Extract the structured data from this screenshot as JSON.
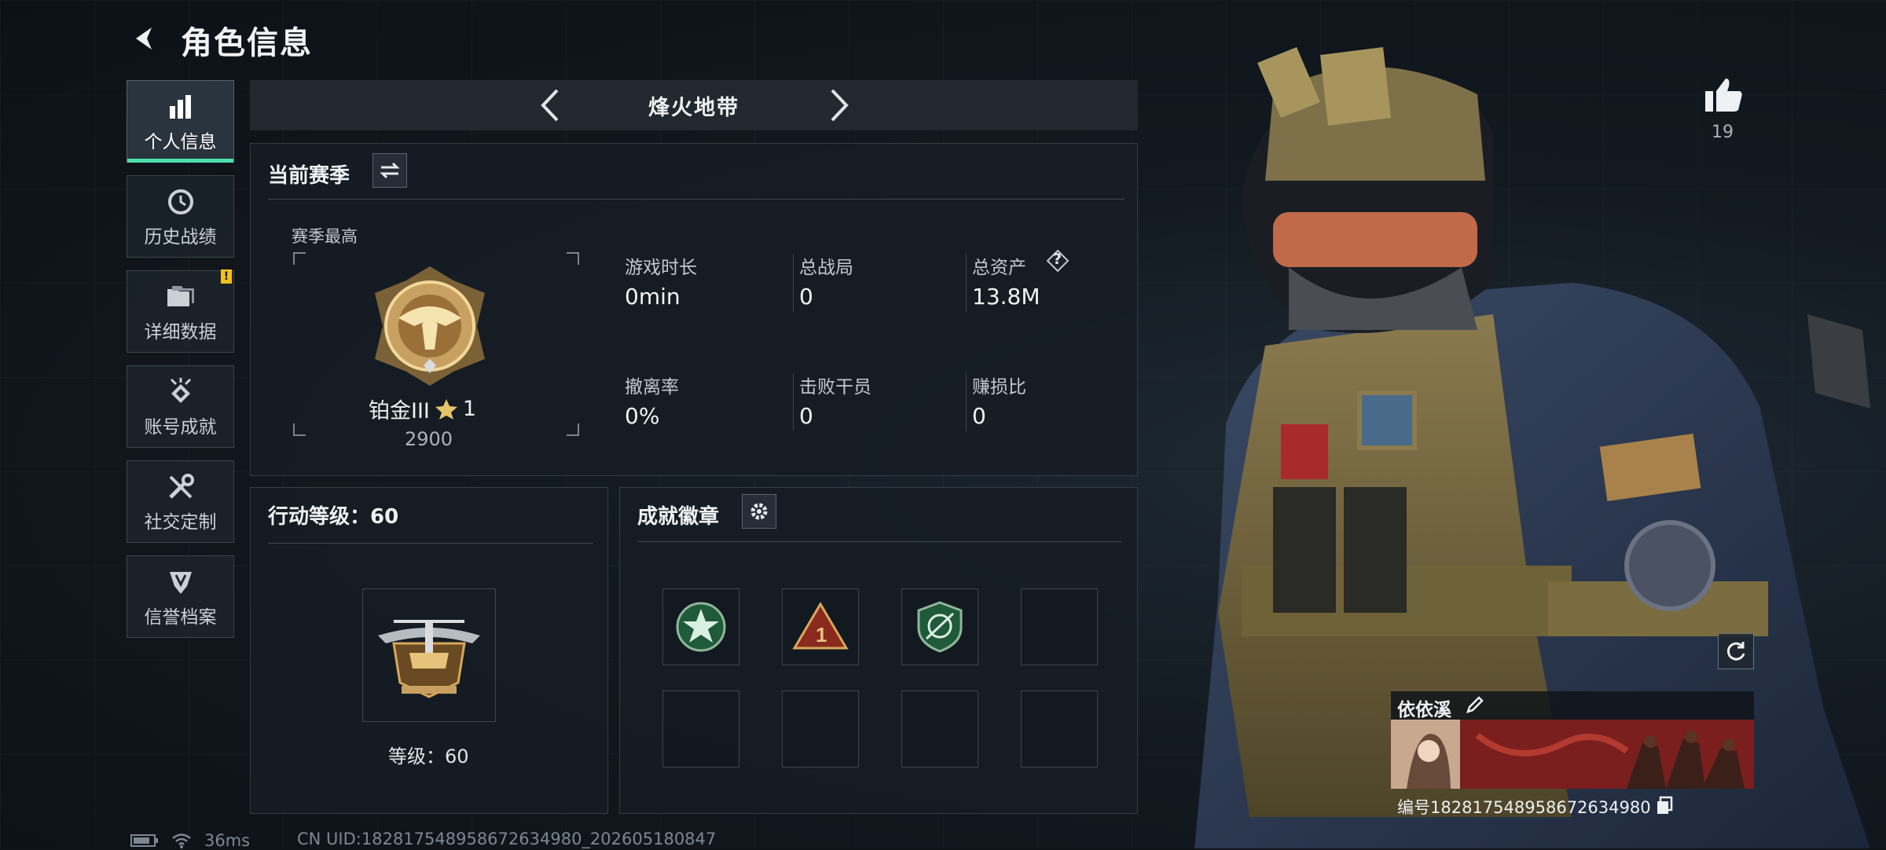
{
  "header": {
    "title": "角色信息"
  },
  "sidebar": {
    "items": [
      {
        "label": "个人信息",
        "icon": "bar-chart-icon",
        "active": true
      },
      {
        "label": "历史战绩",
        "icon": "clock-icon"
      },
      {
        "label": "详细数据",
        "icon": "folder-icon",
        "alert": "!"
      },
      {
        "label": "账号成就",
        "icon": "achievement-icon"
      },
      {
        "label": "社交定制",
        "icon": "tools-icon"
      },
      {
        "label": "信誉档案",
        "icon": "shield-icon"
      }
    ]
  },
  "mode": {
    "title": "烽火地带"
  },
  "season": {
    "title": "当前赛季",
    "best_label": "赛季最高",
    "rank_name": "铂金III",
    "rank_stars": "1",
    "rank_score": "2900",
    "stats": [
      {
        "label": "游戏时长",
        "value": "0min"
      },
      {
        "label": "总战局",
        "value": "0"
      },
      {
        "label": "总资产",
        "value": "13.8M",
        "help": "?"
      },
      {
        "label": "撤离率",
        "value": "0%"
      },
      {
        "label": "击败干员",
        "value": "0"
      },
      {
        "label": "赚损比",
        "value": "0"
      }
    ]
  },
  "action_level": {
    "title": "行动等级：60",
    "level_text": "等级：60"
  },
  "badges": {
    "title": "成就徽章",
    "slots_filled": 3,
    "slots_total": 8
  },
  "profile": {
    "likes": "19",
    "player_name": "依依溪",
    "player_id": "编号1828175489586726349​80"
  },
  "status": {
    "ping": "36ms",
    "uid": "CN UID:1828175489586726349​80_202605180847"
  },
  "colors": {
    "accent": "#4be0a8",
    "gold": "#d6a85a",
    "badge_alert": "#f2c21b"
  }
}
